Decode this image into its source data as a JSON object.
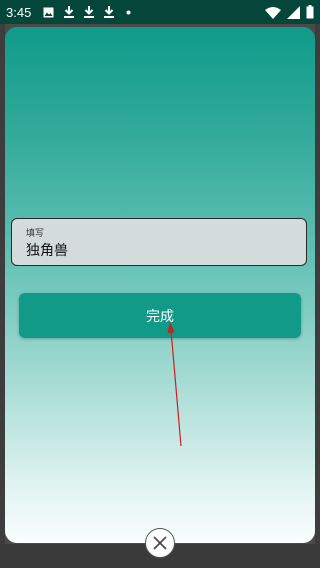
{
  "status_bar": {
    "time": "3:45",
    "left_icons": [
      "image-icon",
      "download-icon",
      "download-icon",
      "download-icon",
      "dot-icon"
    ],
    "right_icons": [
      "wifi-icon",
      "signal-icon",
      "battery-icon"
    ]
  },
  "dialog": {
    "input": {
      "label": "填写",
      "value": "独角兽"
    },
    "done_button": {
      "label": "完成"
    },
    "close_icon": "close-circle-icon"
  },
  "colors": {
    "status_bar": "#04463a",
    "accent": "#129a89",
    "annotation_arrow": "#cc1f1f"
  }
}
